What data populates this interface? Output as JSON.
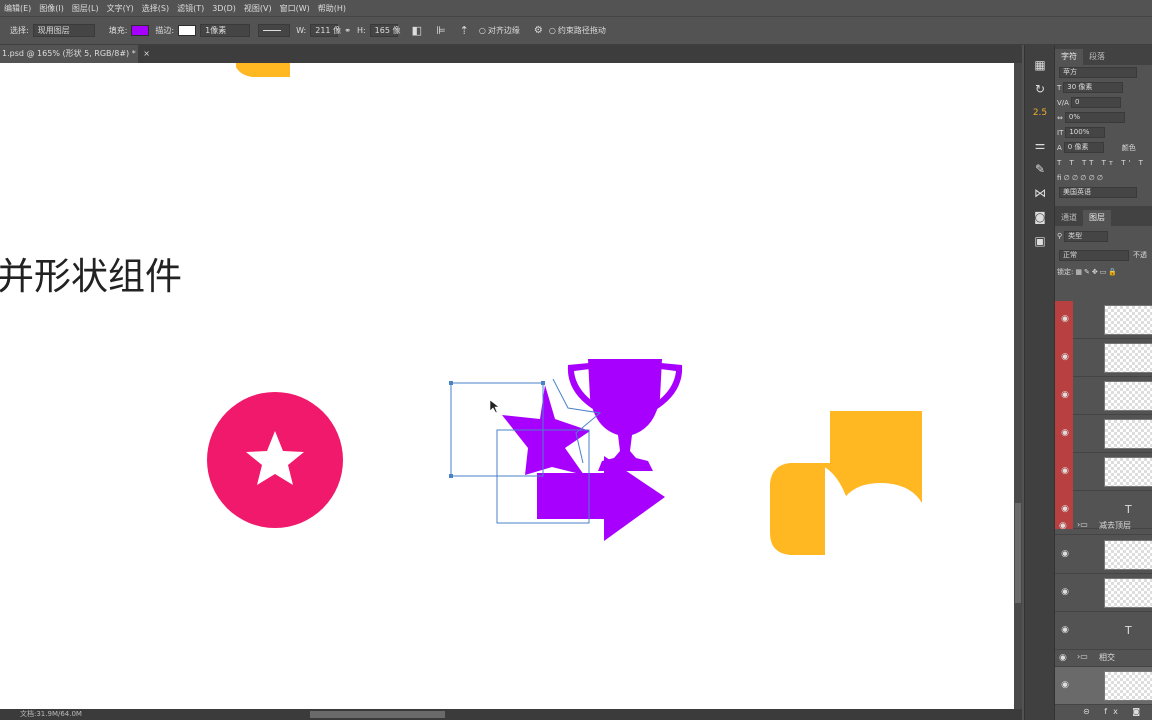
{
  "menu": [
    "编辑(E)",
    "图像(I)",
    "图层(L)",
    "文字(Y)",
    "选择(S)",
    "滤镜(T)",
    "3D(D)",
    "视图(V)",
    "窗口(W)",
    "帮助(H)"
  ],
  "options": {
    "select_label": "选择:",
    "select_value": "现用图层",
    "fill_label": "填充:",
    "stroke_label": "描边:",
    "stroke_width": "1像素",
    "w_label": "W:",
    "w_value": "211 像",
    "h_label": "H:",
    "h_value": "165 像",
    "align_edges": "对齐边缘",
    "constrain_path": "约束路径拖动",
    "fill_color": "#a800ff",
    "stroke_color": "#ffffff"
  },
  "document": {
    "tab_title": "1.psd @ 165% (形状 5, RGB/8#) *",
    "heading": "并形状组件"
  },
  "status": {
    "doc_size": "文档:31.9M/64.0M"
  },
  "colors": {
    "circle": "#f0196c",
    "purple": "#a800ff",
    "gold": "#ffb722"
  },
  "character_panel": {
    "tabs": [
      "字符",
      "段落"
    ],
    "font_family": "苹方",
    "font_size": "30 像素",
    "kerning": "0",
    "tracking": "0%",
    "vscale": "100%",
    "baseline": "0 像素",
    "color_label": "颜色",
    "language": "美国英语"
  },
  "layers_panel": {
    "tabs": [
      "通道",
      "图层"
    ],
    "filter_kind": "类型",
    "blend_mode": "正常",
    "opacity_label": "不透",
    "lock_label": "锁定:",
    "groups": [
      "减去顶层",
      "相交"
    ]
  }
}
